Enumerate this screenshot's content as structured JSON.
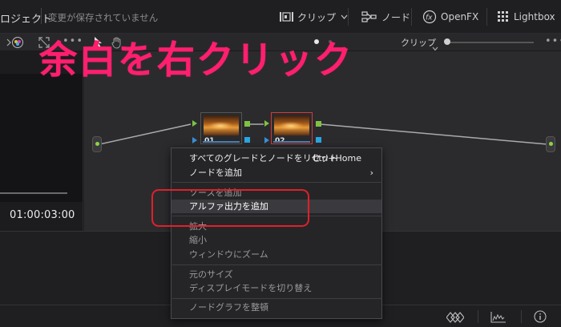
{
  "header": {
    "project_name": "ロジェクト",
    "save_status": "変更が保存されていません",
    "clip_label": "クリップ",
    "node_label": "ノード",
    "openfx_label": "OpenFX",
    "lightbox_label": "Lightbox"
  },
  "toolbar2": {
    "clip_dropdown": "クリップ",
    "dots": "•••"
  },
  "viewer": {
    "timecode": "01:00:03:00"
  },
  "nodes": [
    {
      "label": "01"
    },
    {
      "label": "02"
    }
  ],
  "context_menu": {
    "items": [
      {
        "label": "すべてのグレードとノードをリセット",
        "shortcut": "Ctrl+Home"
      },
      {
        "label": "ノードを追加",
        "arrow": "›"
      },
      {
        "label": "ソースを追加"
      },
      {
        "label": "アルファ出力を追加"
      },
      {
        "label": "拡大"
      },
      {
        "label": "縮小"
      },
      {
        "label": "ウィンドウにズーム"
      },
      {
        "label": "元のサイズ"
      },
      {
        "label": "ディスプレイモードを切り替え"
      },
      {
        "label": "ノードグラフを整頓"
      }
    ]
  },
  "annotation": {
    "text": "余白を右クリック",
    "color": "#ff1f6e",
    "box_color": "#e0202a"
  },
  "colors": {
    "node_port_green": "#7fc242",
    "node_port_blue": "#2ba6e3",
    "selected_node_border": "#d43b3b"
  }
}
